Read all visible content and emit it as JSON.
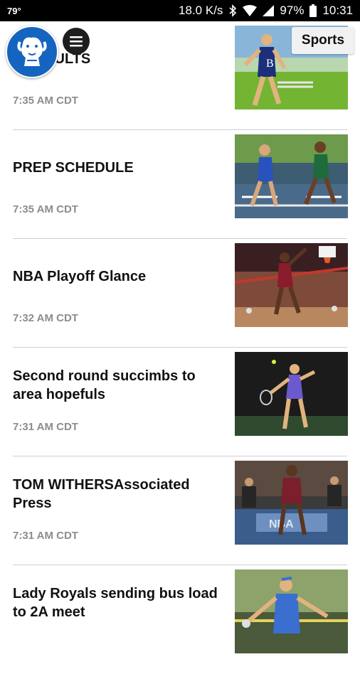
{
  "status_bar": {
    "temperature": "79°",
    "speed": "18.0 K/s",
    "battery": "97%",
    "clock": "10:31"
  },
  "header": {
    "section": "Sports",
    "logo_icon": "bulldog-logo-icon",
    "menu_icon": "hamburger-menu-icon"
  },
  "articles": [
    {
      "title": "L RESULTS",
      "time": "7:35 AM CDT",
      "image": "track-runner-photo"
    },
    {
      "title": "PREP SCHEDULE",
      "time": "7:35 AM CDT",
      "image": "hurdlers-photo"
    },
    {
      "title": "NBA Playoff Glance",
      "time": "7:32 AM CDT",
      "image": "basketball-dunk-photo"
    },
    {
      "title": "Second round succimbs to area hopefuls",
      "time": "7:31 AM CDT",
      "image": "tennis-player-photo"
    },
    {
      "title": "TOM WITHERSAssociated Press",
      "time": "7:31 AM CDT",
      "image": "basketball-bench-photo"
    },
    {
      "title": "Lady Royals sending bus load to 2A meet",
      "time": "",
      "image": "discus-thrower-photo"
    }
  ]
}
